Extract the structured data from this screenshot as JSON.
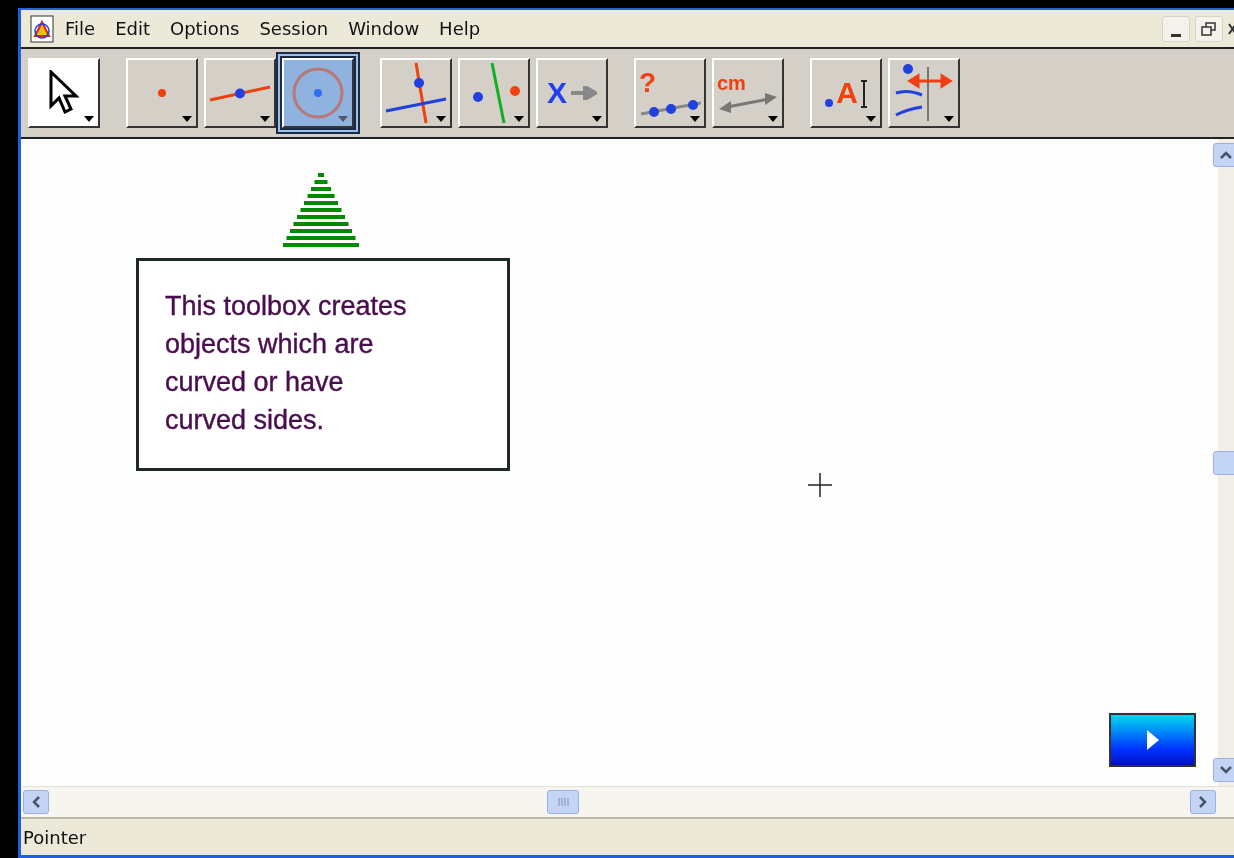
{
  "menu": [
    {
      "label": "File"
    },
    {
      "label": "Edit"
    },
    {
      "label": "Options"
    },
    {
      "label": "Session"
    },
    {
      "label": "Window"
    },
    {
      "label": "Help"
    }
  ],
  "toolbar": {
    "groups": [
      [
        {
          "kind": "pointer",
          "selected": false
        }
      ],
      [
        {
          "kind": "point",
          "selected": false
        },
        {
          "kind": "line",
          "selected": false
        },
        {
          "kind": "circle",
          "selected": true
        }
      ],
      [
        {
          "kind": "perpendicular",
          "selected": false
        },
        {
          "kind": "parallel",
          "selected": false
        },
        {
          "kind": "transform",
          "selected": false,
          "glyph": "X"
        }
      ],
      [
        {
          "kind": "measure",
          "selected": false,
          "glyph": "?"
        },
        {
          "kind": "distance",
          "selected": false,
          "glyph": "cm"
        }
      ],
      [
        {
          "kind": "label",
          "selected": false,
          "glyph": "A"
        },
        {
          "kind": "display",
          "selected": false
        }
      ]
    ]
  },
  "canvas": {
    "callout": {
      "text": "This toolbox creates\nobjects which are\ncurved or have\ncurved sides."
    }
  },
  "status_bar": {
    "text": "Pointer"
  }
}
